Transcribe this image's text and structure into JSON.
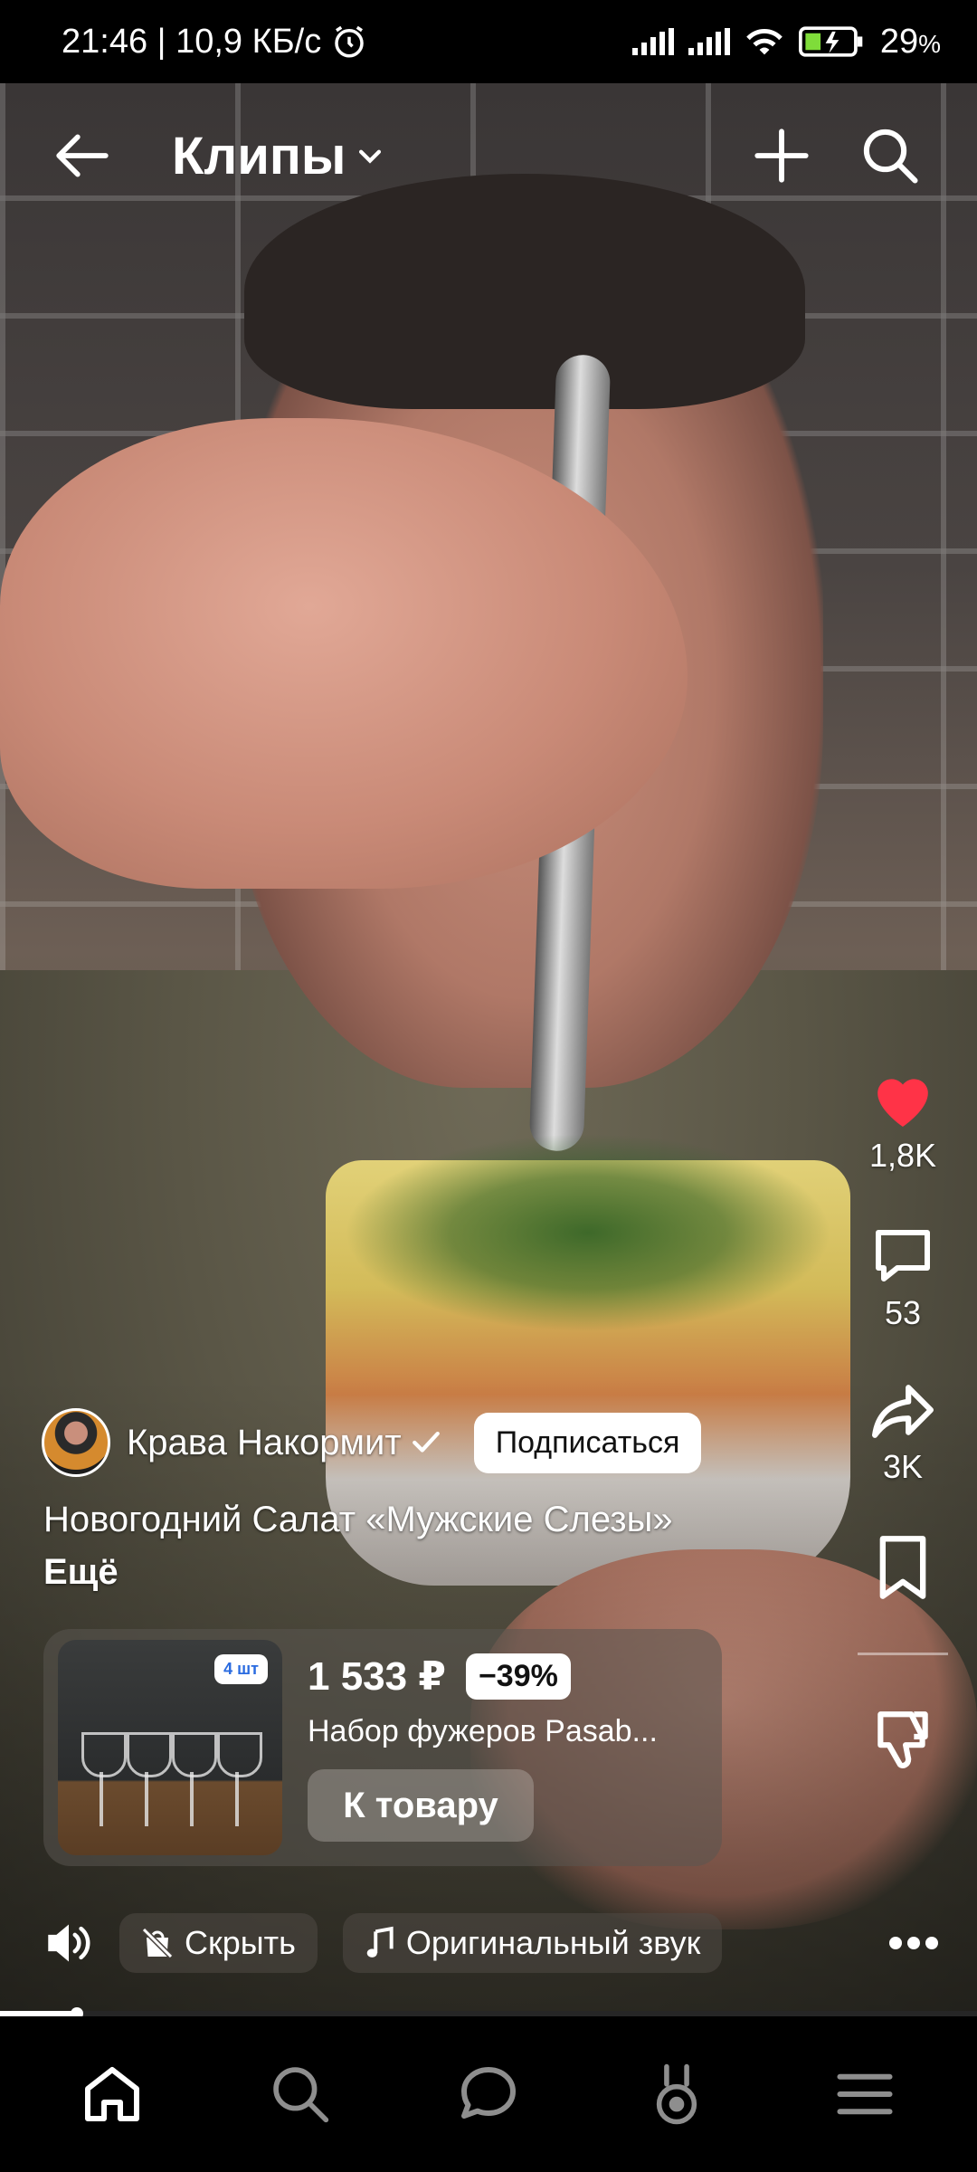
{
  "status_bar": {
    "time_speed": "21:46 | 10,9 КБ/с",
    "battery": "29",
    "battery_unit": "%"
  },
  "header": {
    "title": "Клипы"
  },
  "rail": {
    "likes": "1,8K",
    "comments": "53",
    "shares": "3K"
  },
  "author": {
    "name": "Крава Накормит",
    "subscribe_label": "Подписаться"
  },
  "caption": {
    "text": "Новогодний Салат «Мужские Слезы»",
    "more": "Ещё"
  },
  "product": {
    "badge": "4 шт",
    "price": "1 533 ₽",
    "discount": "−39%",
    "name": "Набор фужеров Pasab...",
    "button_label": "К товару"
  },
  "controls": {
    "hide_label": "Скрыть",
    "sound_label": "Оригинальный звук"
  },
  "playback": {
    "progress": 0.08
  },
  "colors": {
    "like": "#ff3347",
    "badge_text": "#2a6be0"
  }
}
